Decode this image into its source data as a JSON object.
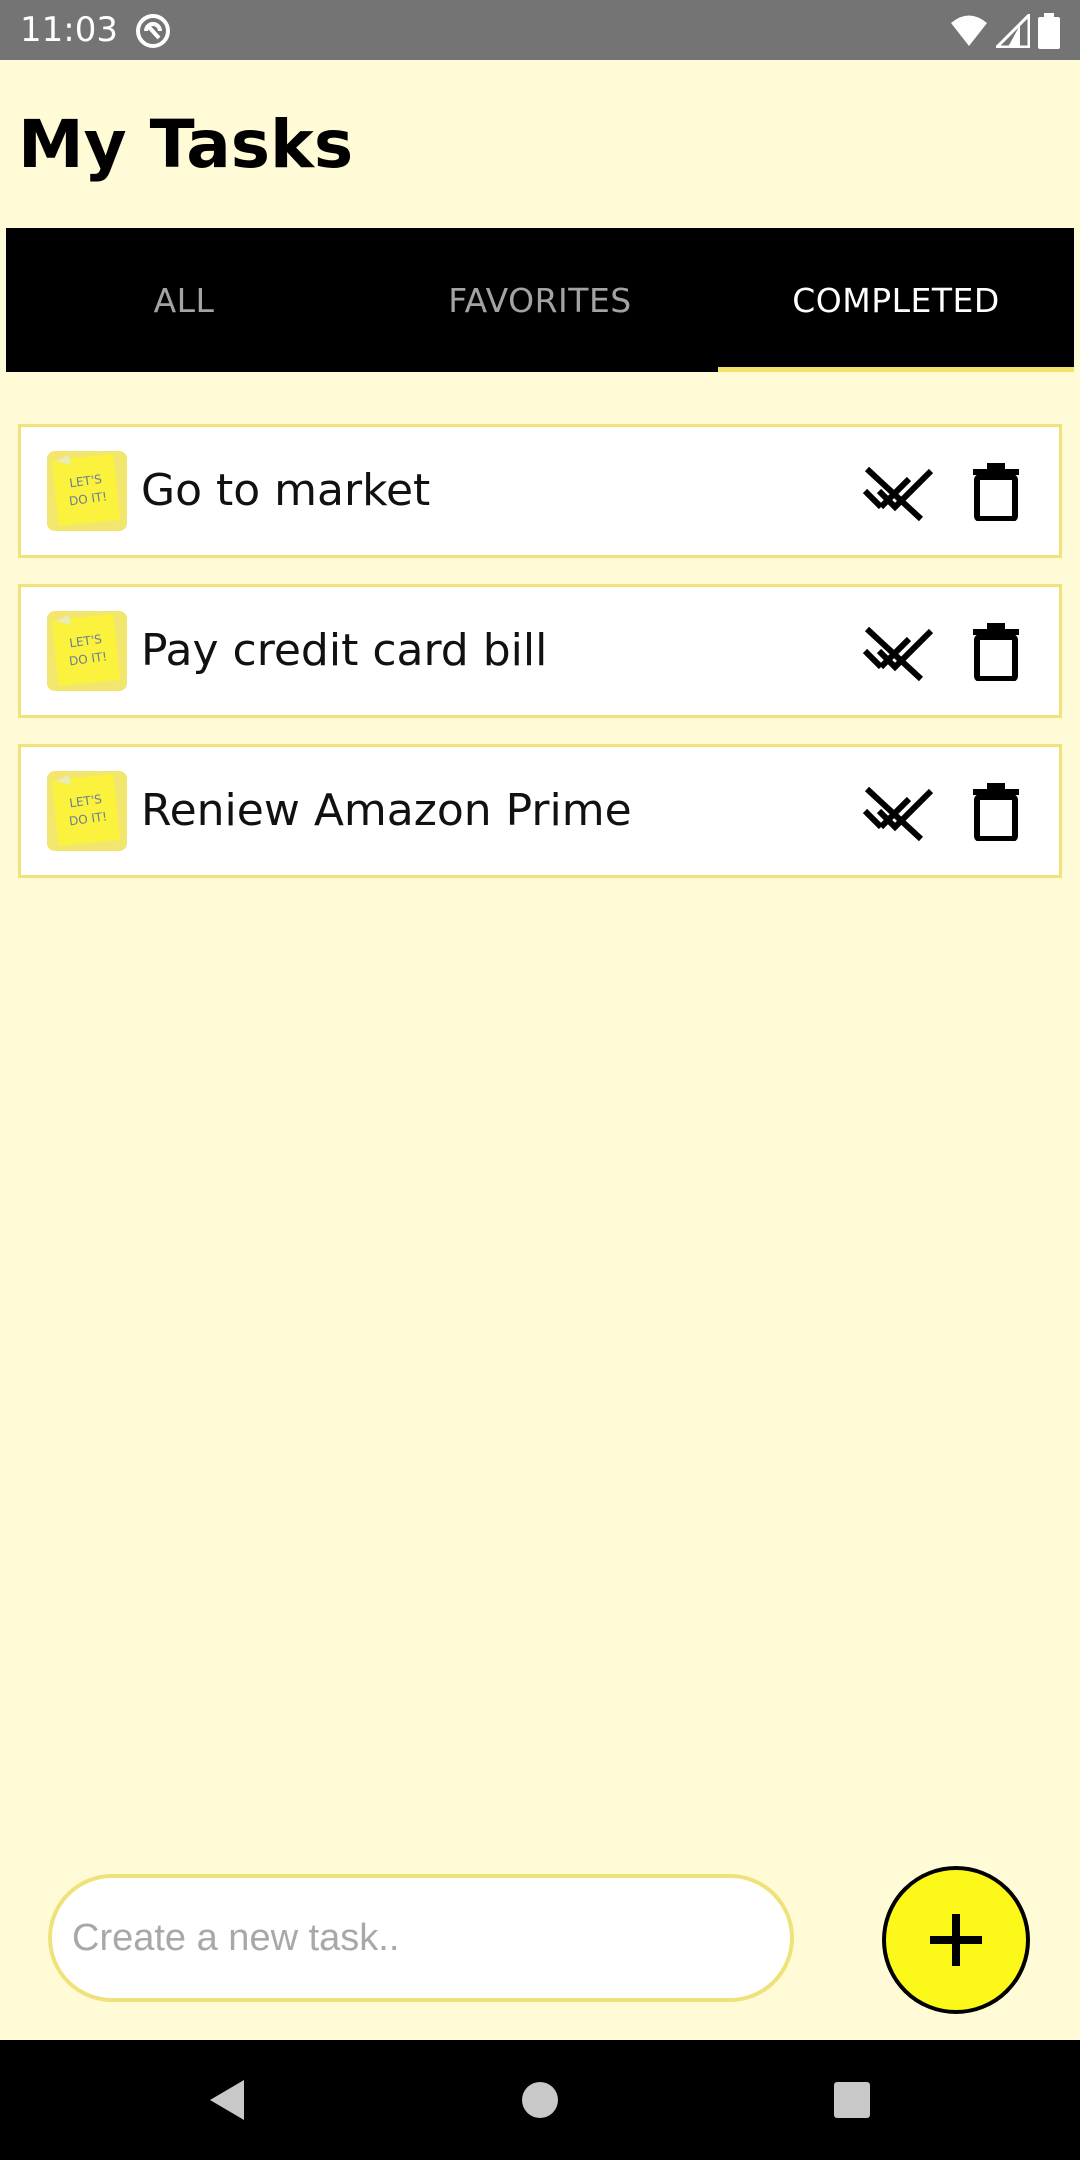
{
  "status_bar": {
    "time": "11:03"
  },
  "header": {
    "title": "My Tasks"
  },
  "tabs": [
    {
      "label": "ALL",
      "active": false
    },
    {
      "label": "FAVORITES",
      "active": false
    },
    {
      "label": "COMPLETED",
      "active": true
    }
  ],
  "tasks": [
    {
      "label": "Go to market",
      "icon": "sticky-note-icon"
    },
    {
      "label": "Pay credit card bill",
      "icon": "sticky-note-icon"
    },
    {
      "label": "Reniew Amazon Prime",
      "icon": "sticky-note-icon"
    }
  ],
  "thumb_text": "LET'S DO IT!",
  "new_task": {
    "placeholder": "Create a new task..",
    "value": ""
  },
  "colors": {
    "background": "#fefbd6",
    "tab_bar": "#000000",
    "tab_indicator": "#f2e36a",
    "card_border": "#f1e27a",
    "fab": "#fbf81a",
    "status_bar": "#747474"
  }
}
